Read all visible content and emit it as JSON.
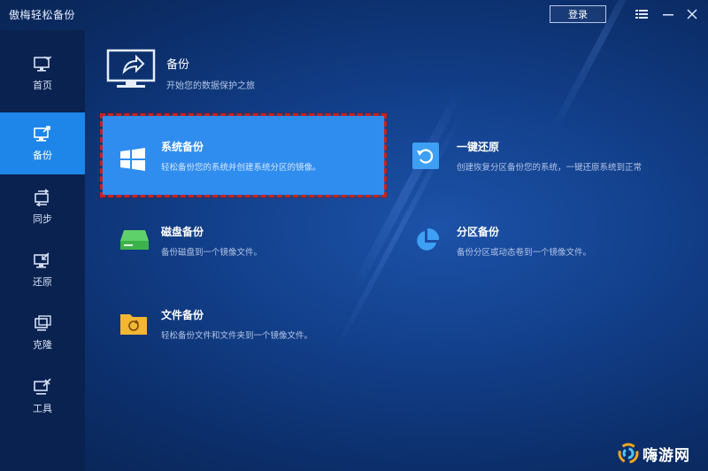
{
  "app": {
    "title": "傲梅轻松备份",
    "login_label": "登录",
    "menu_icon": "menu-icon",
    "minimize_icon": "minimize-icon",
    "close_icon": "close-icon"
  },
  "sidebar": {
    "items": [
      {
        "label": "首页",
        "icon": "home-monitor-icon",
        "active": false
      },
      {
        "label": "备份",
        "icon": "backup-icon",
        "active": true
      },
      {
        "label": "同步",
        "icon": "sync-icon",
        "active": false
      },
      {
        "label": "还原",
        "icon": "restore-icon",
        "active": false
      },
      {
        "label": "克隆",
        "icon": "clone-icon",
        "active": false
      },
      {
        "label": "工具",
        "icon": "tools-icon",
        "active": false
      }
    ]
  },
  "header": {
    "title": "备份",
    "subtitle": "开始您的数据保护之旅"
  },
  "cards": [
    {
      "title": "系统备份",
      "desc": "轻松备份您的系统并创建系统分区的镜像。",
      "icon": "windows-icon",
      "selected": true
    },
    {
      "title": "一键还原",
      "desc": "创建恢复分区备份您的系统，一键还原系统到正常",
      "icon": "one-key-restore-icon",
      "selected": false
    },
    {
      "title": "磁盘备份",
      "desc": "备份磁盘到一个镜像文件。",
      "icon": "disk-icon",
      "selected": false
    },
    {
      "title": "分区备份",
      "desc": "备份分区或动态卷到一个镜像文件。",
      "icon": "partition-icon",
      "selected": false
    },
    {
      "title": "文件备份",
      "desc": "轻松备份文件和文件夹到一个镜像文件。",
      "icon": "folder-icon",
      "selected": false
    }
  ],
  "watermark": {
    "text": "嗨游网"
  },
  "colors": {
    "accent": "#2f8df0",
    "sidebar_active": "#1e86e8",
    "highlight": "#c8231e",
    "background": "#0b2c66"
  }
}
